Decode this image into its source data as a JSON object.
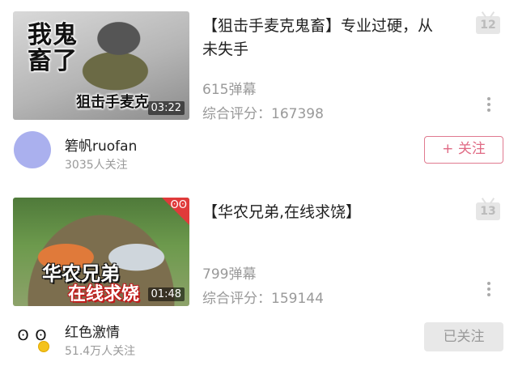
{
  "videos": [
    {
      "thumbnail_caption_main": "我鬼畜了",
      "thumbnail_caption_sub": "狙击手麦克",
      "duration": "03:22",
      "title": "【狙击手麦克鬼畜】专业过硬，从未失手",
      "danmaku": "615弹幕",
      "score_label": "综合评分：",
      "score_value": "167398",
      "badge_number": "12",
      "uploader": {
        "name": "箬帆ruofan",
        "fans": "3035人关注",
        "avatar_color": "#aab0ee"
      },
      "follow_button": "+ 关注",
      "follow_state": "not-followed"
    },
    {
      "thumbnail_caption_main": "华农兄弟",
      "thumbnail_caption_sub": "在线求饶",
      "duration": "01:48",
      "title": "【华农兄弟,在线求饶】",
      "danmaku": "799弹幕",
      "score_label": "综合评分：",
      "score_value": "159144",
      "badge_number": "13",
      "uploader": {
        "name": "红色激情",
        "fans": "51.4万人关注",
        "avatar_glyph": "ʘ ʘ"
      },
      "follow_button": "已关注",
      "follow_state": "followed"
    }
  ],
  "colors": {
    "follow_accent": "#e06a84",
    "muted_text": "#999999",
    "badge_bg": "#e6e6e6"
  }
}
